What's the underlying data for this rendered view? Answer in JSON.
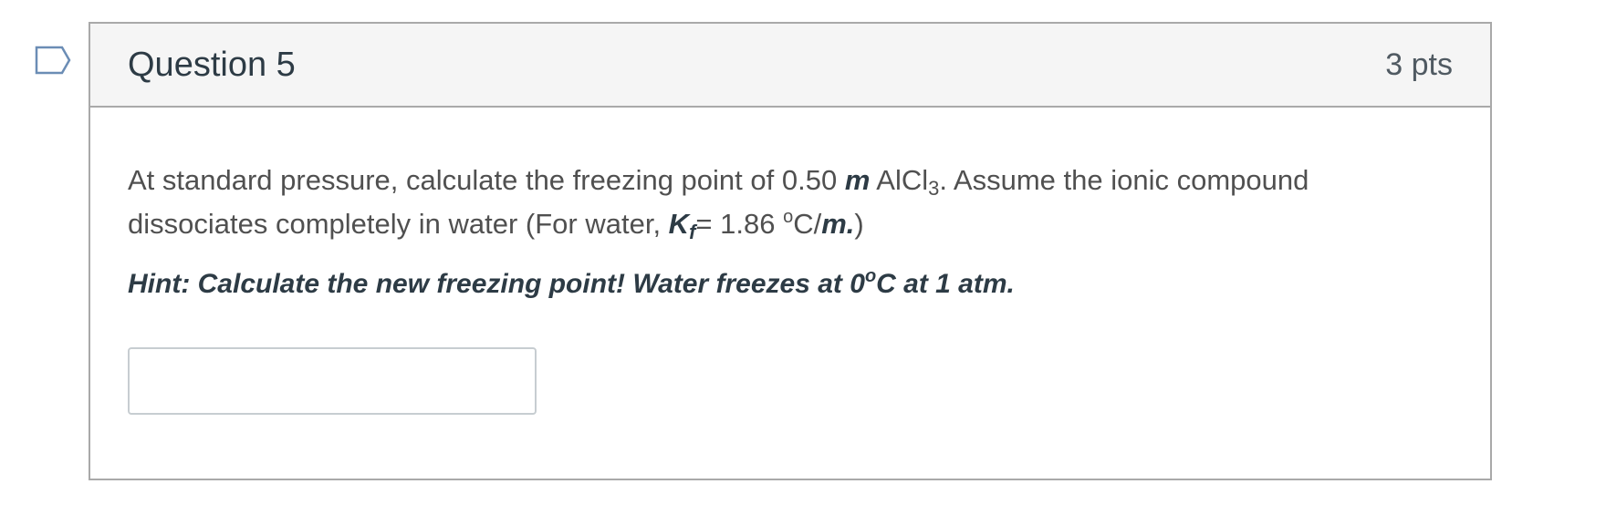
{
  "question": {
    "title": "Question 5",
    "points": "3 pts",
    "flag_icon": "bookmark-flag-icon",
    "text": {
      "p1": "At standard pressure, calculate the freezing point of 0.50 ",
      "molal_m": "m",
      "p2": " AlCl",
      "sub3": "3",
      "p3": ". Assume the ionic compound dissociates completely in water (For water, ",
      "K": "K",
      "f": "f",
      "p4": "= 1.86 ",
      "deg": "o",
      "p5": "C/",
      "m_dot": "m.",
      "p6": ")"
    },
    "hint": {
      "p1": "Hint: Calculate the new freezing point! Water freezes at 0",
      "deg": "o",
      "p2": "C at 1 atm."
    },
    "answer": {
      "value": "",
      "placeholder": ""
    }
  },
  "colors": {
    "header_bg": "#f5f5f5",
    "border": "#a9a9a9",
    "flag_stroke": "#6b8db5",
    "text": "#505050",
    "heading": "#2d3b45"
  }
}
